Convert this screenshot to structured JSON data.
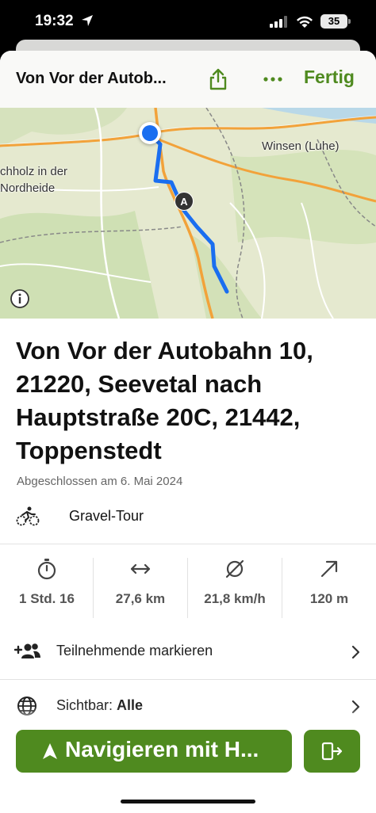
{
  "status_bar": {
    "time": "19:32",
    "battery": "35"
  },
  "header": {
    "title": "Von Vor der Autob...",
    "done_label": "Fertig"
  },
  "map": {
    "labels": {
      "winsen": "Winsen (Luhe)",
      "holz": "chholz in der",
      "heide": "Nordheide"
    },
    "waypoint_marker": "A"
  },
  "tour": {
    "title": "Von Vor der Autobahn 10, 21220, Seevetal nach Hauptstraße 20C, 21442, Toppenstedt",
    "completed": "Abgeschlossen am 6. Mai 2024",
    "sport": "Gravel-Tour"
  },
  "stats": [
    {
      "icon": "stopwatch-icon",
      "value": "1 Std. 16"
    },
    {
      "icon": "distance-arrows-icon",
      "value": "27,6 km"
    },
    {
      "icon": "average-speed-icon",
      "value": "21,8 km/h"
    },
    {
      "icon": "elevation-up-icon",
      "value": "120 m"
    }
  ],
  "rows": {
    "participants": "Teilnehmende markieren",
    "visibility_prefix": "Sichtbar: ",
    "visibility_value": "Alle"
  },
  "buttons": {
    "navigate": "Navigieren mit H..."
  },
  "colors": {
    "accent": "#4f8a1f",
    "route": "#1a6ef0"
  }
}
